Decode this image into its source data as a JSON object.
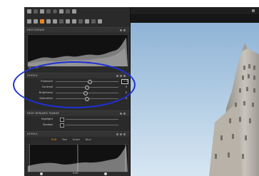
{
  "panels": {
    "histogram": {
      "title": "HISTOGRAM",
      "readout": "ISO 100"
    },
    "levels": {
      "title": "LEVELS",
      "sliders": [
        {
          "label": "Exposure",
          "value": "0.0",
          "position": 0.55
        },
        {
          "label": "Contrast",
          "value": "0",
          "position": 0.5
        },
        {
          "label": "Brightness",
          "value": "0",
          "position": 0.48
        },
        {
          "label": "Saturation",
          "value": "0",
          "position": 0.5
        }
      ]
    },
    "highlights": {
      "title": "HIGH DYNAMIC RANGE",
      "sliders": [
        {
          "label": "Highlight",
          "value": "0"
        },
        {
          "label": "Shadow",
          "value": "0"
        }
      ]
    },
    "curves": {
      "title": "LEVELS",
      "tabs": [
        "RGB",
        "Red",
        "Green",
        "Blue"
      ],
      "footer_value": "0.00"
    }
  },
  "colors": {
    "accent": "#e8871e",
    "annotation": "#1f30d6"
  },
  "icons": [
    "camera-icon",
    "undo-icon",
    "redo-icon",
    "settings-icon",
    "folder-icon",
    "capture-icon",
    "crop-icon",
    "pen-icon"
  ]
}
